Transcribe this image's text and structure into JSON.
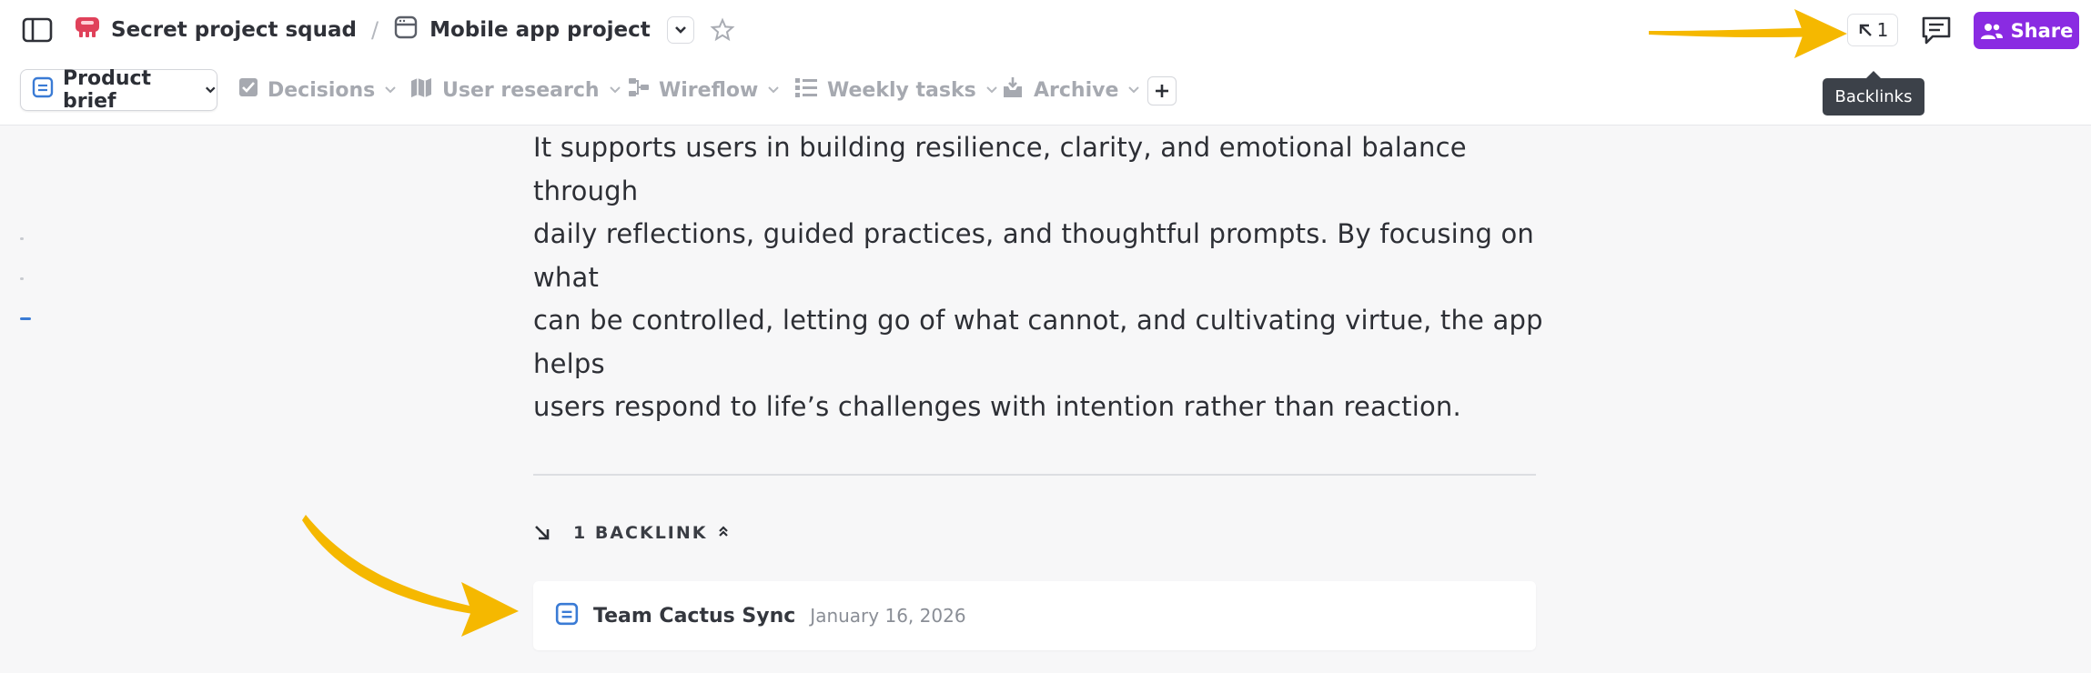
{
  "breadcrumb": {
    "workspace": "Secret project squad",
    "separator": "/",
    "project": "Mobile app project"
  },
  "header": {
    "backlinks_count": "1",
    "tooltip": "Backlinks",
    "share_label": "Share"
  },
  "tabs": [
    {
      "label": "Product brief",
      "icon": "doc-icon",
      "active": true
    },
    {
      "label": "Decisions",
      "icon": "checkbox-icon"
    },
    {
      "label": "User research",
      "icon": "map-icon"
    },
    {
      "label": "Wireflow",
      "icon": "flow-icon"
    },
    {
      "label": "Weekly tasks",
      "icon": "list-icon"
    },
    {
      "label": "Archive",
      "icon": "archive-icon"
    }
  ],
  "content": {
    "paragraph_lines": [
      "It supports users in building resilience, clarity, and emotional balance through",
      "daily reflections, guided practices, and thoughtful prompts. By focusing on what",
      "can be controlled, letting go of what cannot, and cultivating virtue, the app helps",
      "users respond to life’s challenges with intention rather than reaction."
    ]
  },
  "backlinks": {
    "header": "1 BACKLINK",
    "items": [
      {
        "title": "Team Cactus Sync",
        "date": "January 16, 2026"
      }
    ]
  },
  "colors": {
    "accent": "#8a2be2",
    "annotation_arrow": "#f5b800",
    "doc_icon": "#3a7bd5"
  }
}
